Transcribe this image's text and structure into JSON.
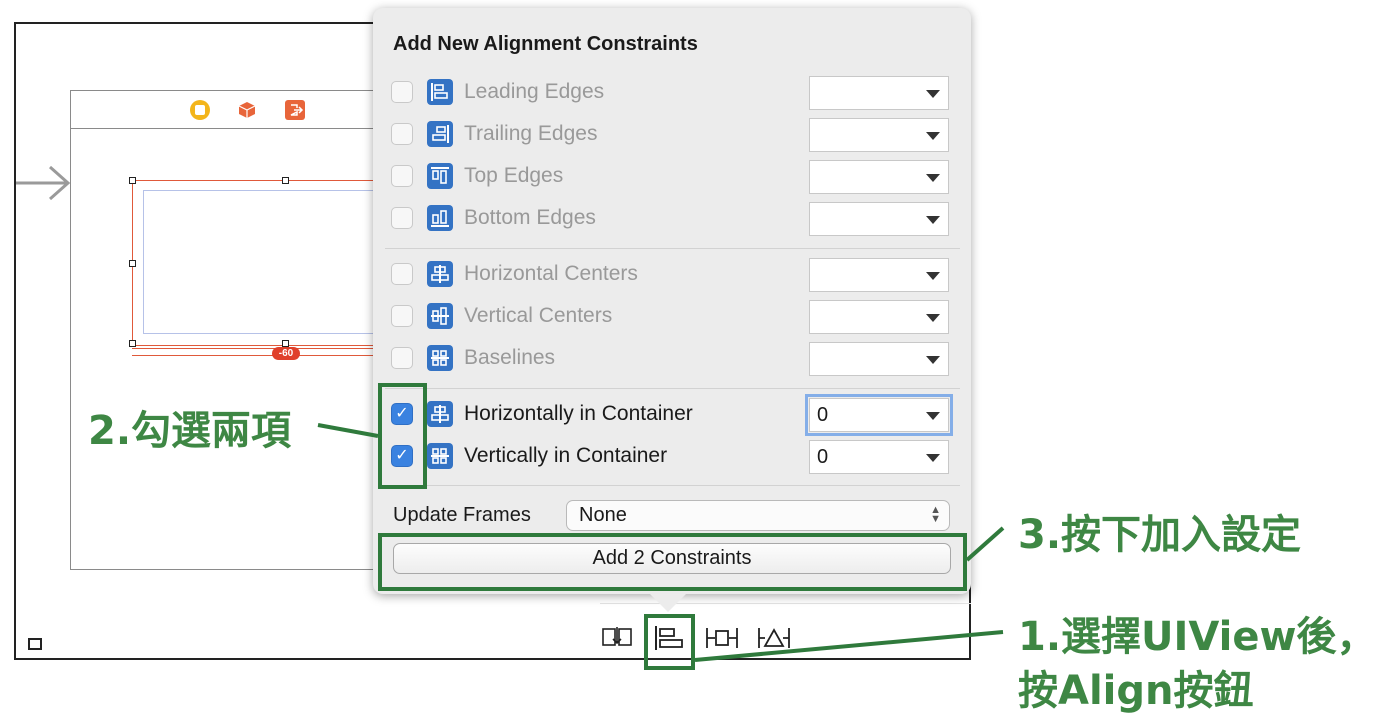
{
  "popover": {
    "title": "Add New Alignment Constraints",
    "rows": [
      {
        "label": "Leading Edges",
        "checked": false,
        "value": "",
        "icon": "leading-edges-icon"
      },
      {
        "label": "Trailing Edges",
        "checked": false,
        "value": "",
        "icon": "trailing-edges-icon"
      },
      {
        "label": "Top Edges",
        "checked": false,
        "value": "",
        "icon": "top-edges-icon"
      },
      {
        "label": "Bottom Edges",
        "checked": false,
        "value": "",
        "icon": "bottom-edges-icon"
      },
      {
        "label": "Horizontal Centers",
        "checked": false,
        "value": "",
        "icon": "horizontal-centers-icon"
      },
      {
        "label": "Vertical Centers",
        "checked": false,
        "value": "",
        "icon": "vertical-centers-icon"
      },
      {
        "label": "Baselines",
        "checked": false,
        "value": "",
        "icon": "baselines-icon"
      },
      {
        "label": "Horizontally in Container",
        "checked": true,
        "value": "0",
        "icon": "horizontally-in-container-icon"
      },
      {
        "label": "Vertically in Container",
        "checked": true,
        "value": "0",
        "icon": "vertically-in-container-icon"
      }
    ],
    "update_frames_label": "Update Frames",
    "update_frames_value": "None",
    "add_button_label": "Add 2 Constraints"
  },
  "canvas": {
    "constraint_badge": "-60"
  },
  "annotations": {
    "step1_line1": "1.選擇UIView後，",
    "step1_line2": "按Align按鈕",
    "step2": "2.勾選兩項",
    "step3": "3.按下加入設定"
  },
  "colors": {
    "annotation_green": "#2f7a3c",
    "checkbox_blue": "#3a82e0",
    "icon_blue": "#3473c4",
    "selection_orange": "#e0593a"
  }
}
